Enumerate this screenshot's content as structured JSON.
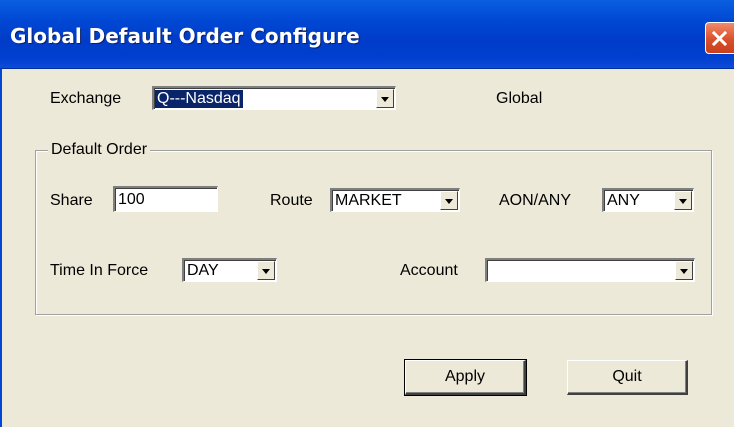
{
  "window": {
    "title": "Global Default Order Configure"
  },
  "exchange": {
    "label": "Exchange",
    "value": "Q---Nasdaq",
    "scope": "Global"
  },
  "default_order": {
    "legend": "Default Order",
    "share_label": "Share",
    "share_value": "100",
    "route_label": "Route",
    "route_value": "MARKET",
    "aon_label": "AON/ANY",
    "aon_value": "ANY",
    "tif_label": "Time In Force",
    "tif_value": "DAY",
    "account_label": "Account",
    "account_value": ""
  },
  "buttons": {
    "apply": "Apply",
    "quit": "Quit"
  },
  "colors": {
    "titlebar": "#0048d4",
    "face": "#ece9d8",
    "close": "#d9512b",
    "selection": "#0a246a"
  },
  "icons": {
    "close": "close-icon",
    "dropdown": "chevron-down-icon"
  }
}
